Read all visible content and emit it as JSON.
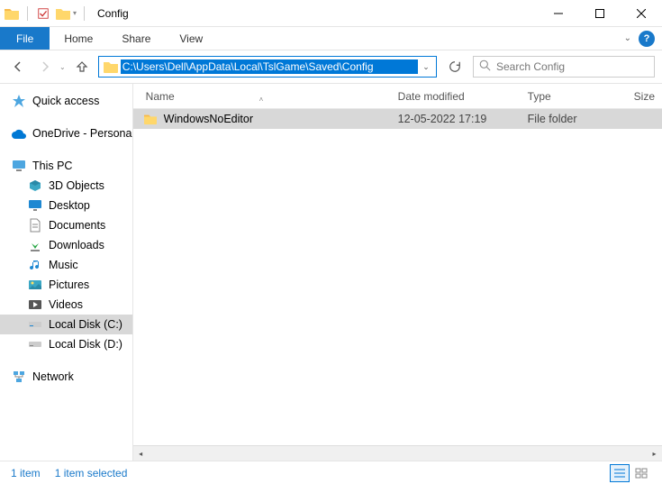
{
  "window": {
    "title": "Config"
  },
  "ribbon": {
    "file": "File",
    "tabs": [
      "Home",
      "Share",
      "View"
    ]
  },
  "address": {
    "path": "C:\\Users\\Dell\\AppData\\Local\\TslGame\\Saved\\Config"
  },
  "search": {
    "placeholder": "Search Config"
  },
  "sidebar": {
    "quick_access": "Quick access",
    "onedrive": "OneDrive - Persona",
    "this_pc": "This PC",
    "pc_items": [
      "3D Objects",
      "Desktop",
      "Documents",
      "Downloads",
      "Music",
      "Pictures",
      "Videos",
      "Local Disk (C:)",
      "Local Disk (D:)"
    ],
    "network": "Network"
  },
  "columns": {
    "name": "Name",
    "date": "Date modified",
    "type": "Type",
    "size": "Size"
  },
  "rows": [
    {
      "name": "WindowsNoEditor",
      "date": "12-05-2022 17:19",
      "type": "File folder",
      "size": "",
      "selected": true
    }
  ],
  "status": {
    "count": "1 item",
    "selected": "1 item selected"
  }
}
